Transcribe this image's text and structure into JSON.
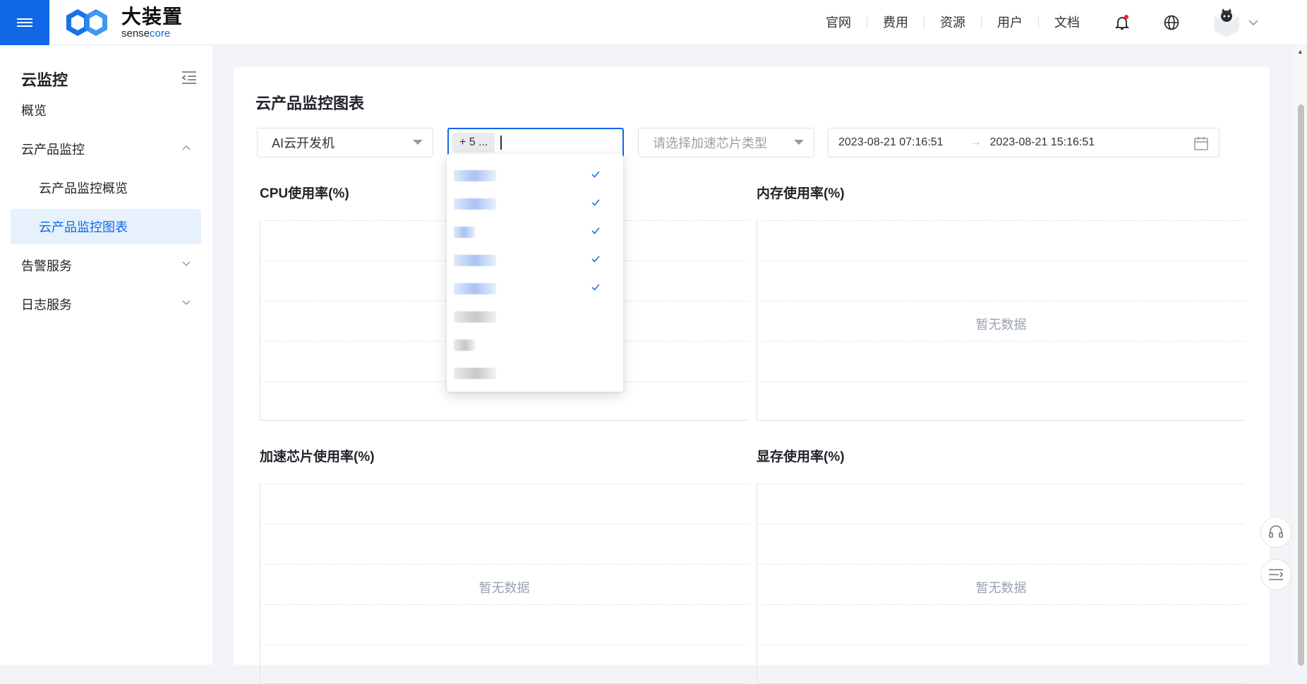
{
  "brand": {
    "name_cn": "大装置",
    "name_en_a": "sense",
    "name_en_b": "core"
  },
  "topnav": [
    "官网",
    "费用",
    "资源",
    "用户",
    "文档"
  ],
  "sidebar": {
    "title": "云监控",
    "items": [
      {
        "label": "概览"
      },
      {
        "label": "云产品监控"
      },
      {
        "label": "云产品监控概览"
      },
      {
        "label": "云产品监控图表"
      },
      {
        "label": "告警服务"
      },
      {
        "label": "日志服务"
      }
    ]
  },
  "main": {
    "title": "云产品监控图表",
    "filters": {
      "product": "AI云开发机",
      "instance_tag": "+ 5 ...",
      "chip_placeholder": "请选择加速芯片类型",
      "start": "2023-08-21 07:16:51",
      "end": "2023-08-21 15:16:51"
    },
    "charts": [
      {
        "title": "CPU使用率(%)",
        "nodata": ""
      },
      {
        "title": "内存使用率(%)",
        "nodata": "暂无数据"
      },
      {
        "title": "加速芯片使用率(%)",
        "nodata": "暂无数据"
      },
      {
        "title": "显存使用率(%)",
        "nodata": "暂无数据"
      }
    ]
  },
  "dropdown": {
    "options": [
      {
        "selected": true,
        "tone": "blue"
      },
      {
        "selected": true,
        "tone": "blue"
      },
      {
        "selected": true,
        "tone": "blue-small"
      },
      {
        "selected": true,
        "tone": "blue"
      },
      {
        "selected": true,
        "tone": "blue"
      },
      {
        "selected": false,
        "tone": "gray"
      },
      {
        "selected": false,
        "tone": "gray-small"
      },
      {
        "selected": false,
        "tone": "gray"
      }
    ]
  },
  "colors": {
    "accent": "#1068e6",
    "active_bg": "#e6f1fc",
    "nodata": "#9aa3b1"
  }
}
